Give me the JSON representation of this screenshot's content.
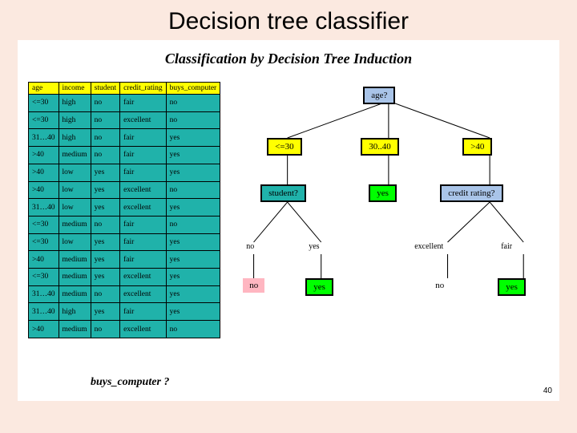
{
  "title": "Decision tree classifier",
  "panel_title": "Classification by Decision Tree Induction",
  "table": {
    "headers": [
      "age",
      "income",
      "student",
      "credit_rating",
      "buys_computer"
    ],
    "rows": [
      [
        "<=30",
        "high",
        "no",
        "fair",
        "no"
      ],
      [
        "<=30",
        "high",
        "no",
        "excellent",
        "no"
      ],
      [
        "31…40",
        "high",
        "no",
        "fair",
        "yes"
      ],
      [
        ">40",
        "medium",
        "no",
        "fair",
        "yes"
      ],
      [
        ">40",
        "low",
        "yes",
        "fair",
        "yes"
      ],
      [
        ">40",
        "low",
        "yes",
        "excellent",
        "no"
      ],
      [
        "31…40",
        "low",
        "yes",
        "excellent",
        "yes"
      ],
      [
        "<=30",
        "medium",
        "no",
        "fair",
        "no"
      ],
      [
        "<=30",
        "low",
        "yes",
        "fair",
        "yes"
      ],
      [
        ">40",
        "medium",
        "yes",
        "fair",
        "yes"
      ],
      [
        "<=30",
        "medium",
        "yes",
        "excellent",
        "yes"
      ],
      [
        "31…40",
        "medium",
        "no",
        "excellent",
        "yes"
      ],
      [
        "31…40",
        "high",
        "yes",
        "fair",
        "yes"
      ],
      [
        ">40",
        "medium",
        "no",
        "excellent",
        "no"
      ]
    ]
  },
  "tree": {
    "root": "age?",
    "branches": {
      "le30": {
        "label": "<=30",
        "node": "student?",
        "children": {
          "no": {
            "label": "no",
            "leaf": "no"
          },
          "yes": {
            "label": "yes",
            "leaf": "yes"
          }
        }
      },
      "mid": {
        "label": "30..40",
        "leaf": "yes"
      },
      "gt40": {
        "label": ">40",
        "node": "credit rating?",
        "children": {
          "excellent": {
            "label": "excellent",
            "leaf": "no"
          },
          "fair": {
            "label": "fair",
            "leaf": "yes"
          }
        }
      }
    }
  },
  "footer_question": "buys_computer ?",
  "page_number": "40"
}
